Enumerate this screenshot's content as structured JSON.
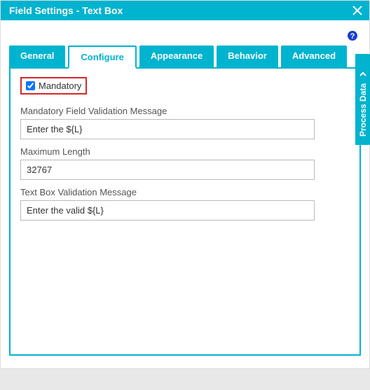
{
  "window": {
    "title": "Field Settings - Text Box"
  },
  "tabs": {
    "general": "General",
    "configure": "Configure",
    "appearance": "Appearance",
    "behavior": "Behavior",
    "advanced": "Advanced"
  },
  "configure": {
    "mandatory_label": "Mandatory",
    "mandatory_msg_label": "Mandatory Field Validation Message",
    "mandatory_msg_value": "Enter the ${L}",
    "max_length_label": "Maximum Length",
    "max_length_value": "32767",
    "textbox_msg_label": "Text Box Validation Message",
    "textbox_msg_value": "Enter the valid ${L}"
  },
  "sideDrawer": {
    "label": "Process Data"
  }
}
